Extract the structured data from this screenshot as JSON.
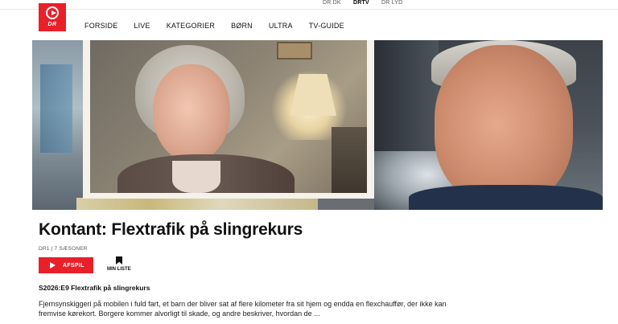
{
  "topbar": {
    "sites": [
      {
        "label": "DR.DK",
        "active": false
      },
      {
        "label": "DRTV",
        "active": true
      },
      {
        "label": "DR LYD",
        "active": false
      }
    ]
  },
  "logo": {
    "text": "DR",
    "color": "#e8202a"
  },
  "nav": {
    "items": [
      "FORSIDE",
      "LIVE",
      "KATEGORIER",
      "BØRN",
      "ULTRA",
      "TV-GUIDE"
    ]
  },
  "show": {
    "title": "Kontant: Flextrafik på slingrekurs",
    "meta": "DR1 | 7 SÆSONER",
    "play_label": "AFSPIL",
    "mylist_label": "MIN LISTE",
    "episode_title": "S2026:E9 Flextrafik på slingrekurs",
    "description": "Fjernsynskiggeri på mobilen i fuld fart, et barn der bliver sat af flere kilometer fra sit hjem og endda en flexchauffør, der ikke kan fremvise kørekort. Borgere kommer alvorligt til skade, og andre beskriver, hvordan de ..."
  },
  "colors": {
    "accent": "#e8202a"
  },
  "icons": {
    "play": "play-icon",
    "bookmark": "bookmark-icon",
    "logo": "dr-logo-icon"
  }
}
